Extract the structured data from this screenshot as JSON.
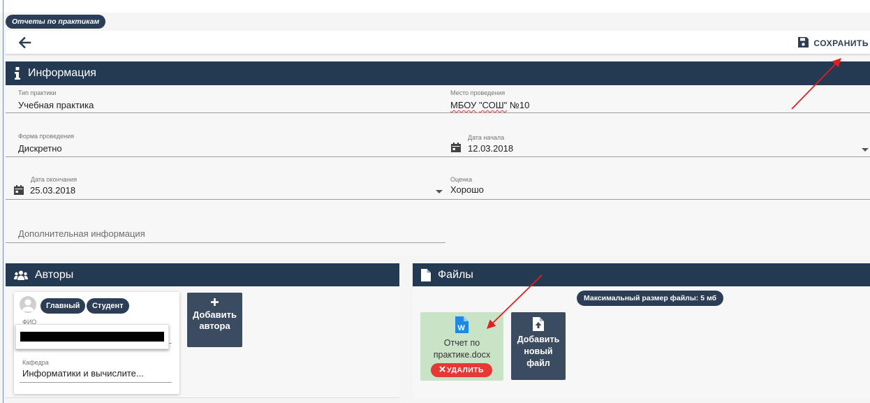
{
  "breadcrumb": "Отчеты по практикам",
  "toolbar": {
    "save_label": "СОХРАНИТЬ"
  },
  "info": {
    "title": "Информация",
    "fields": {
      "practice_type": {
        "label": "Тип практики",
        "value": "Учебная практика"
      },
      "location": {
        "label": "Место проведения",
        "value_prefix": "МБОУ",
        "value_mid": "\"СОШ\"",
        "value_suffix": "№10"
      },
      "form": {
        "label": "Форма проведения",
        "value": "Дискретно"
      },
      "start_date": {
        "label": "Дата начала",
        "value": "12.03.2018"
      },
      "end_date": {
        "label": "Дата окончания",
        "value": "25.03.2018"
      },
      "grade": {
        "label": "Оценка",
        "value": "Хорошо"
      },
      "extra": {
        "placeholder": "Дополнительная информация"
      }
    }
  },
  "authors": {
    "title": "Авторы",
    "card": {
      "chips": [
        "Главный",
        "Студент"
      ],
      "name_label": "ФИО",
      "dept_label": "Кафедра",
      "dept_value": "Информатики и вычислите..."
    },
    "add_label_line1": "Добавить",
    "add_label_line2": "автора"
  },
  "files": {
    "title": "Файлы",
    "max_size": "Максимальный размер файлы: 5 мб",
    "file": {
      "name_line1": "Отчет по",
      "name_line2": "практике.docx",
      "delete_label": "УДАЛИТЬ"
    },
    "add_line1": "Добавить",
    "add_line2": "новый",
    "add_line3": "файл"
  },
  "colors": {
    "header": "#243a53",
    "chip": "#2c3e56",
    "button": "#3b4b60",
    "file_card": "#c9e3c6",
    "delete": "#e53935",
    "annotation_arrow": "#e02020"
  },
  "icons": {
    "back": "arrow-left-icon",
    "save": "floppy-disk-icon",
    "info": "info-icon",
    "calendar": "calendar-icon",
    "users": "users-icon",
    "file": "file-icon",
    "word": "word-document-icon",
    "upload": "file-upload-icon",
    "close": "close-icon",
    "dropdown": "caret-down-icon"
  }
}
